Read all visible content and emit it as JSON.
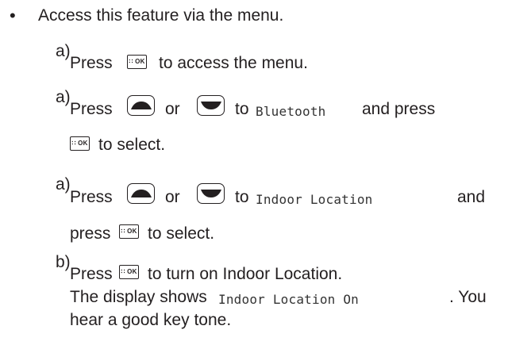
{
  "bullet": {
    "symbol": "•",
    "text": "Access this feature via the menu."
  },
  "steps": [
    {
      "marker": "a)",
      "press": "Press",
      "rest": "to access the menu."
    },
    {
      "marker": "a)",
      "press": "Press",
      "or": "or",
      "to": "to",
      "mono": "Bluetooth",
      "and_press": "and press",
      "select": "to select."
    },
    {
      "marker": "a)",
      "press": "Press",
      "or": "or",
      "to": "to",
      "mono": "Indoor Location",
      "and": "and",
      "press_lower": "press",
      "select": "to select."
    },
    {
      "marker": "b)",
      "press": "Press",
      "rest": "to turn on Indoor Location.",
      "display_prefix": "The display shows",
      "display_mono": "Indoor Location On",
      "display_suffix": ". You",
      "tone": "hear a good key tone."
    }
  ],
  "icons": {
    "ok_key": {
      "name": "menu-ok-key",
      "label_grid": "∷",
      "label_ok": "OK"
    },
    "up_key": {
      "name": "up-navigation-key"
    },
    "down_key": {
      "name": "down-navigation-key"
    }
  }
}
